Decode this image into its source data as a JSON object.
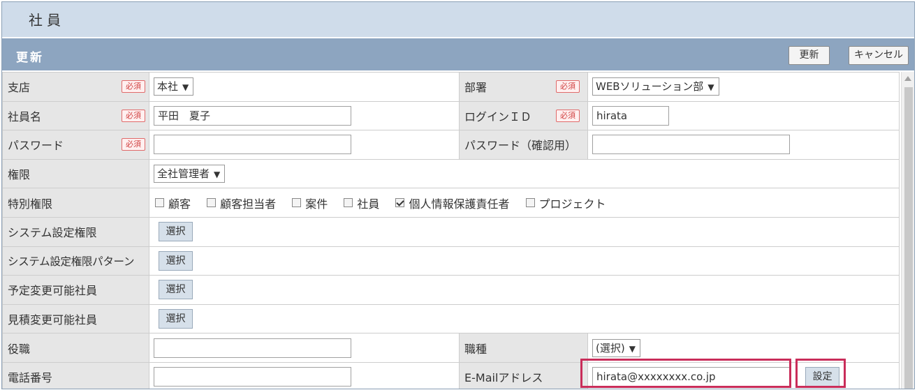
{
  "page": {
    "title": "社員"
  },
  "section": {
    "label": "更新",
    "update_label": "更新",
    "cancel_label": "キャンセル"
  },
  "required_badge": "必須",
  "pick_label": "選択",
  "fields": {
    "branch": {
      "label": "支店",
      "value": "本社"
    },
    "department": {
      "label": "部署",
      "value": "WEBソリューション部"
    },
    "employee_name": {
      "label": "社員名",
      "value": "平田　夏子"
    },
    "login_id": {
      "label": "ログインＩＤ",
      "value": "hirata"
    },
    "password": {
      "label": "パスワード",
      "value": ""
    },
    "password_confirm": {
      "label": "パスワード（確認用）",
      "value": ""
    },
    "authority": {
      "label": "権限",
      "value": "全社管理者"
    },
    "special_authority": {
      "label": "特別権限",
      "options": [
        {
          "label": "顧客",
          "checked": false
        },
        {
          "label": "顧客担当者",
          "checked": false
        },
        {
          "label": "案件",
          "checked": false
        },
        {
          "label": "社員",
          "checked": false
        },
        {
          "label": "個人情報保護責任者",
          "checked": true
        },
        {
          "label": "プロジェクト",
          "checked": false
        }
      ]
    },
    "system_settings_authority": {
      "label": "システム設定権限"
    },
    "system_settings_pattern": {
      "label": "システム設定権限パターン"
    },
    "schedule_editors": {
      "label": "予定変更可能社員"
    },
    "estimate_editors": {
      "label": "見積変更可能社員"
    },
    "position": {
      "label": "役職",
      "value": ""
    },
    "job_type": {
      "label": "職種",
      "value": "(選択)"
    },
    "phone": {
      "label": "電話番号",
      "value": ""
    },
    "email": {
      "label": "E-Mailアドレス",
      "value": "hirata@xxxxxxxx.co.jp",
      "set_label": "設定"
    }
  },
  "colors": {
    "title_bg": "#cfdcea",
    "section_bg": "#8da5c0",
    "label_bg": "#e6e6e6",
    "highlight": "#c92d5a",
    "required": "#d04040"
  }
}
